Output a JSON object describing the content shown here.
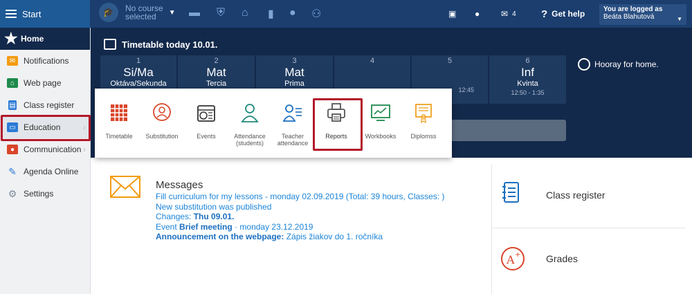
{
  "topbar": {
    "start_label": "Start",
    "course_line1": "No course",
    "course_line2": "selected",
    "messages_count": "4",
    "get_help": "Get help",
    "logged_label": "You are logged as",
    "user_name": "Beáta Blahutová"
  },
  "sidebar": {
    "items": [
      {
        "label": "Home",
        "icon": "star-icon"
      },
      {
        "label": "Notifications",
        "icon": "envelope-icon"
      },
      {
        "label": "Web page",
        "icon": "house-icon"
      },
      {
        "label": "Class register",
        "icon": "register-icon"
      },
      {
        "label": "Education",
        "icon": "book-icon"
      },
      {
        "label": "Communication",
        "icon": "chat-icon"
      },
      {
        "label": "Agenda Online",
        "icon": "pen-icon"
      },
      {
        "label": "Settings",
        "icon": "gear-icon"
      }
    ]
  },
  "timetable": {
    "title": "Timetable today 10.01.",
    "lessons": [
      {
        "num": "1",
        "subject": "Si/Ma",
        "class": "Oktáva/Sekunda",
        "time": ""
      },
      {
        "num": "2",
        "subject": "Mat",
        "class": "Tercia",
        "time": ""
      },
      {
        "num": "3",
        "subject": "Mat",
        "class": "Prima",
        "time": ""
      },
      {
        "num": "4",
        "subject": "",
        "class": "",
        "time": ""
      },
      {
        "num": "5",
        "subject": "",
        "class": "",
        "time": "12:45"
      },
      {
        "num": "6",
        "subject": "Inf",
        "class": "Kvinta",
        "time": "12:50 - 1:35"
      }
    ],
    "hooray": "Hooray for home."
  },
  "education_menu": {
    "items": [
      {
        "label": "Timetable"
      },
      {
        "label": "Substitution"
      },
      {
        "label": "Events"
      },
      {
        "label": "Attendance (students)"
      },
      {
        "label": "Teacher attendance"
      },
      {
        "label": "Reports"
      },
      {
        "label": "Workbooks"
      },
      {
        "label": "Diplomss"
      }
    ]
  },
  "messages": {
    "title": "Messages",
    "line1": "Fill curriculum for my lessons - monday 02.09.2019 (Total: 39 hours, Classes: )",
    "line2": "New substitution was published",
    "line3_prefix": "Changes:",
    "line3_bold": "Thu 09.01.",
    "line4_prefix": "Event",
    "line4_bold": "Brief meeting",
    "line4_suffix": "· monday 23.12.2019",
    "line5_bold": "Announcement on the webpage:",
    "line5_suffix": "Zápis žiakov do 1. ročníka"
  },
  "shortcuts": [
    {
      "label": "Class register"
    },
    {
      "label": "Grades"
    }
  ],
  "colors": {
    "topbar": "#1b3e6f",
    "dark_bg": "#13294b",
    "highlight_red": "#b3182a",
    "link_blue": "#1b84d8"
  }
}
